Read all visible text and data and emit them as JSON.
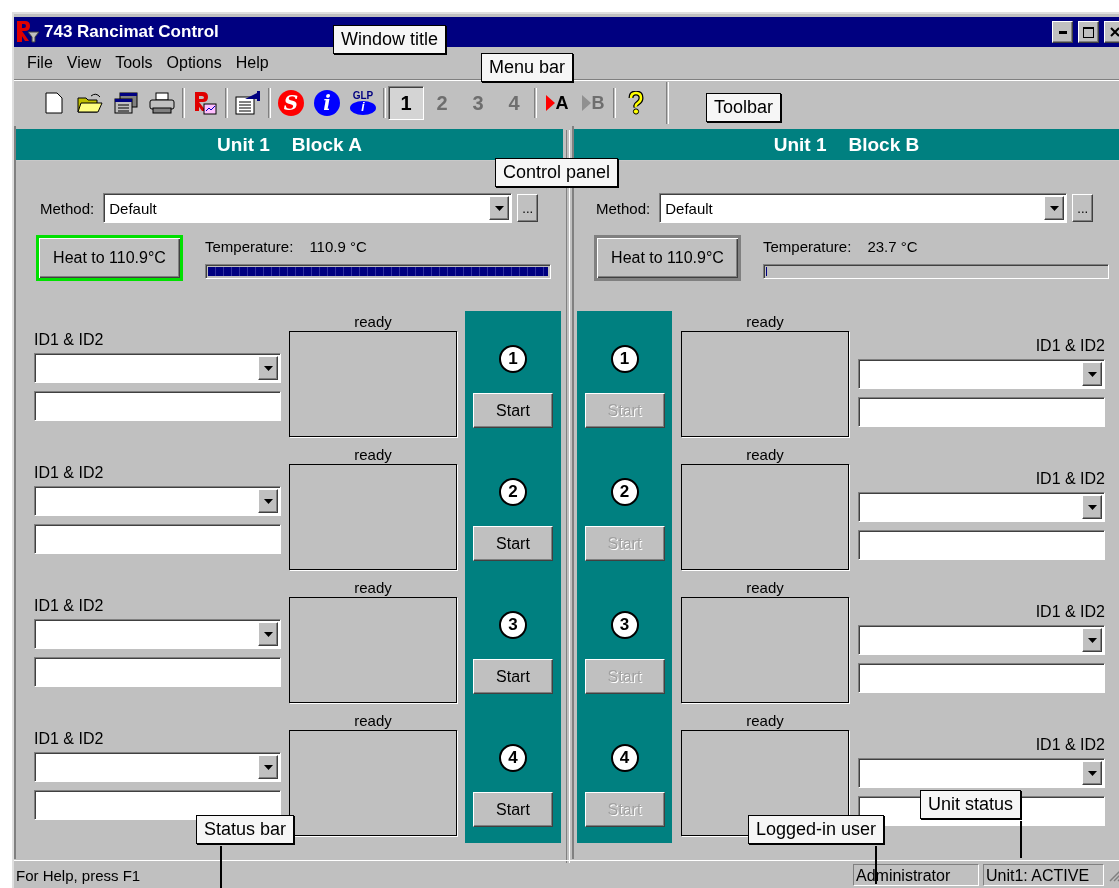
{
  "window": {
    "title": "743 Rancimat Control"
  },
  "menu_bar": [
    "File",
    "View",
    "Tools",
    "Options",
    "Help"
  ],
  "toolbar": [
    {
      "kind": "new"
    },
    {
      "kind": "open"
    },
    {
      "kind": "windows"
    },
    {
      "kind": "print"
    },
    {
      "kind": "separator"
    },
    {
      "kind": "report"
    },
    {
      "kind": "separator"
    },
    {
      "kind": "properties"
    },
    {
      "kind": "separator"
    },
    {
      "kind": "badge",
      "text": "S",
      "color": "#ff0000"
    },
    {
      "kind": "badge",
      "text": "i",
      "color": "#0000ff"
    },
    {
      "kind": "glp",
      "text": "GLP",
      "subtext": "i"
    },
    {
      "kind": "separator"
    },
    {
      "kind": "unit",
      "text": "1",
      "selected": true,
      "disabled": false
    },
    {
      "kind": "unit",
      "text": "2",
      "selected": false,
      "disabled": true
    },
    {
      "kind": "unit",
      "text": "3",
      "selected": false,
      "disabled": true
    },
    {
      "kind": "unit",
      "text": "4",
      "selected": false,
      "disabled": true
    },
    {
      "kind": "separator"
    },
    {
      "kind": "block",
      "text": "A",
      "disabled": false
    },
    {
      "kind": "block",
      "text": "B",
      "disabled": true
    },
    {
      "kind": "separator"
    },
    {
      "kind": "help"
    }
  ],
  "blocks": [
    {
      "unit": "Unit 1",
      "block": "Block A",
      "method_label": "Method:",
      "method": "Default",
      "more_button": "...",
      "heat_button": {
        "label": "Heat to 110.9°C",
        "active": true
      },
      "temperature_label": "Temperature:",
      "temperature": "110.9 °C",
      "heating": {
        "level": 1
      },
      "positions": [
        {
          "number": "1",
          "status": "ready",
          "id_label": "ID1 & ID2",
          "start": "Start",
          "disabled": false
        },
        {
          "number": "2",
          "status": "ready",
          "id_label": "ID1 & ID2",
          "start": "Start",
          "disabled": false
        },
        {
          "number": "3",
          "status": "ready",
          "id_label": "ID1 & ID2",
          "start": "Start",
          "disabled": false
        },
        {
          "number": "4",
          "status": "ready",
          "id_label": "ID1 & ID2",
          "start": "Start",
          "disabled": false
        }
      ]
    },
    {
      "unit": "Unit 1",
      "block": "Block B",
      "method_label": "Method:",
      "method": "Default",
      "more_button": "...",
      "heat_button": {
        "label": "Heat to 110.9°C",
        "active": false
      },
      "temperature_label": "Temperature:",
      "temperature": "23.7 °C",
      "heating": {
        "level": 0
      },
      "positions": [
        {
          "number": "1",
          "status": "ready",
          "id_label": "ID1 & ID2",
          "start": "Start",
          "disabled": true
        },
        {
          "number": "2",
          "status": "ready",
          "id_label": "ID1 & ID2",
          "start": "Start",
          "disabled": true
        },
        {
          "number": "3",
          "status": "ready",
          "id_label": "ID1 & ID2",
          "start": "Start",
          "disabled": true
        },
        {
          "number": "4",
          "status": "ready",
          "id_label": "ID1 & ID2",
          "start": "Start",
          "disabled": true
        }
      ]
    }
  ],
  "status_bar": {
    "help": "For Help, press F1",
    "user": "Administrator",
    "unit_status": "Unit1: ACTIVE"
  },
  "callouts": [
    {
      "text": "Window title",
      "leader": false
    },
    {
      "text": "Menu bar",
      "leader": false
    },
    {
      "text": "Toolbar",
      "leader": false
    },
    {
      "text": "Control panel",
      "leader": false
    },
    {
      "text": "Status bar",
      "leader": true
    },
    {
      "text": "Logged-in user",
      "leader": true
    },
    {
      "text": "Unit status",
      "leader": true
    }
  ]
}
